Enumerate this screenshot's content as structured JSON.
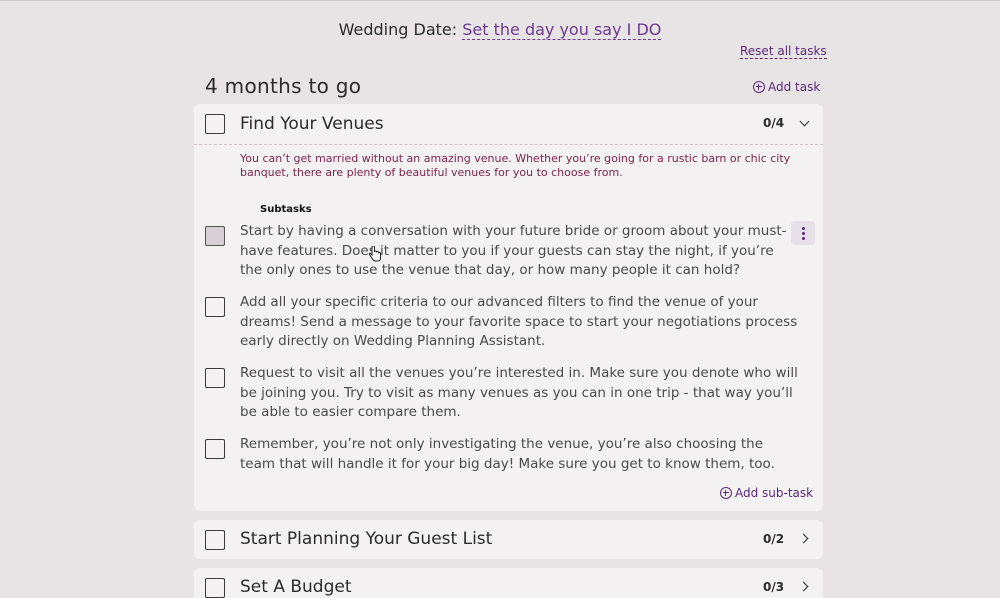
{
  "header": {
    "wedding_date_label": "Wedding Date:",
    "wedding_date_link": "Set the day you say I DO",
    "reset_all": "Reset all tasks"
  },
  "section": {
    "title": "4 months to go",
    "add_task": "Add task"
  },
  "tasks": [
    {
      "title": "Find Your Venues",
      "count": "0/4",
      "expanded": true,
      "description": "You can’t get married without an amazing venue. Whether you’re going for a rustic barn or chic city banquet, there are plenty of beautiful venues for you to choose from.",
      "subtasks_label": "Subtasks",
      "subtasks": [
        "Start by having a conversation with your future bride or groom about your must-have features. Does it matter to you if your guests can stay the night, if you’re the only ones to use the venue that day, or how many people it can hold?",
        "Add all your specific criteria to our advanced filters to find the venue of your dreams! Send a message to your favorite space to start your negotiations process early directly on Wedding Planning Assistant.",
        "Request to visit all the venues you’re interested in. Make sure you denote who will be joining you. Try to visit as many venues as you can in one trip - that way you’ll be able to easier compare them.",
        "Remember, you’re not only investigating the venue, you’re also choosing the team that will handle it for your big day! Make sure you get to know them, too."
      ],
      "add_subtask": "Add sub-task"
    },
    {
      "title": "Start Planning Your Guest List",
      "count": "0/2",
      "expanded": false
    },
    {
      "title": "Set A Budget",
      "count": "0/3",
      "expanded": false
    }
  ],
  "colors": {
    "accent": "#5a2a7a",
    "description": "#7a2548",
    "background": "#e8e4e6",
    "card": "#f4f1f2"
  }
}
